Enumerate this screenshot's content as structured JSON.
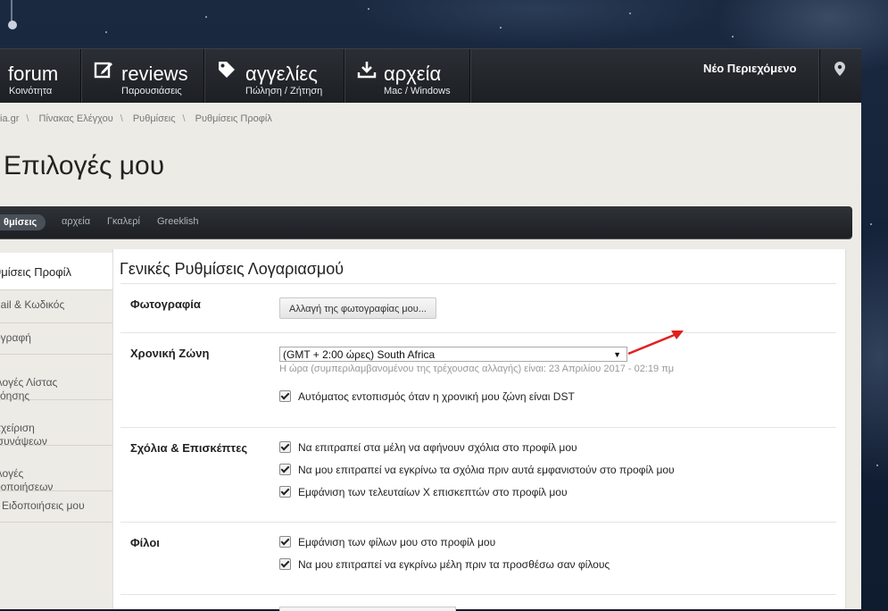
{
  "nav": {
    "items": [
      {
        "title": "forum",
        "subtitle": "Κοινότητα",
        "icon": "none"
      },
      {
        "title": "reviews",
        "subtitle": "Παρουσιάσεις",
        "icon": "edit-icon"
      },
      {
        "title": "αγγελίες",
        "subtitle": "Πώληση / Ζήτηση",
        "icon": "tag-icon"
      },
      {
        "title": "αρχεία",
        "subtitle": "Mac / Windows",
        "icon": "download-icon"
      }
    ],
    "new_content": "Νέο Περιεχόμενο",
    "location_icon": "map-pin-icon"
  },
  "breadcrumbs": [
    "ia.gr",
    "Πίνακας Ελέγχου",
    "Ρυθμίσεις",
    "Ρυθμίσεις Προφίλ"
  ],
  "breadcrumb_separator": "\\",
  "page_title": "Επιλογές μου",
  "subnav": {
    "active": "θμίσεις",
    "links": [
      "αρχεία",
      "Γκαλερί",
      "Greeklish"
    ]
  },
  "sidebar": {
    "items": [
      {
        "label": "θμίσεις Προφίλ",
        "active": true
      },
      {
        "label": "nail & Κωδικός",
        "active": false
      },
      {
        "label": "ογραφή",
        "active": false
      },
      {
        "label": "ιλογές Λίστας\nνόησης",
        "active": false
      },
      {
        "label": "αχείριση\nισυνάψεων",
        "active": false
      },
      {
        "label": "ιλογές\nδοποιήσεων",
        "active": false
      },
      {
        "label": "Ειδοποιήσεις μου",
        "active": false
      }
    ]
  },
  "panel": {
    "title": "Γενικές Ρυθμίσεις Λογαριασμού",
    "photo": {
      "label": "Φωτογραφία",
      "button": "Αλλαγή της φωτογραφίας μου..."
    },
    "timezone": {
      "label": "Χρονική Ζώνη",
      "selected": "(GMT + 2:00 ώρες) South Africa",
      "hint": "Η ώρα (συμπεριλαμβανομένου της τρέχουσας αλλαγής) είναι: 23 Απριλίου 2017 - 02:19 πμ",
      "dst": "Αυτόματος εντοπισμός όταν η χρονική μου ζώνη είναι DST"
    },
    "comments": {
      "label": "Σχόλια & Επισκέπτες",
      "options": [
        "Να επιτραπεί στα μέλη να αφήνουν σχόλια στο προφίλ μου",
        "Να μου επιτραπεί να εγκρίνω τα σχόλια πριν αυτά εμφανιστούν στο προφίλ μου",
        "Εμφάνιση των τελευταίων Χ επισκεπτών στο προφίλ μου"
      ]
    },
    "friends": {
      "label": "Φίλοι",
      "options": [
        "Εμφάνιση των φίλων μου στο προφίλ μου",
        "Να μου επιτραπεί να εγκρίνω μέλη πριν τα προσθέσω σαν φίλους"
      ]
    }
  },
  "colors": {
    "accent_arrow": "#e02020",
    "nav_bg": "#23272c",
    "content_bg": "#edebe6"
  }
}
